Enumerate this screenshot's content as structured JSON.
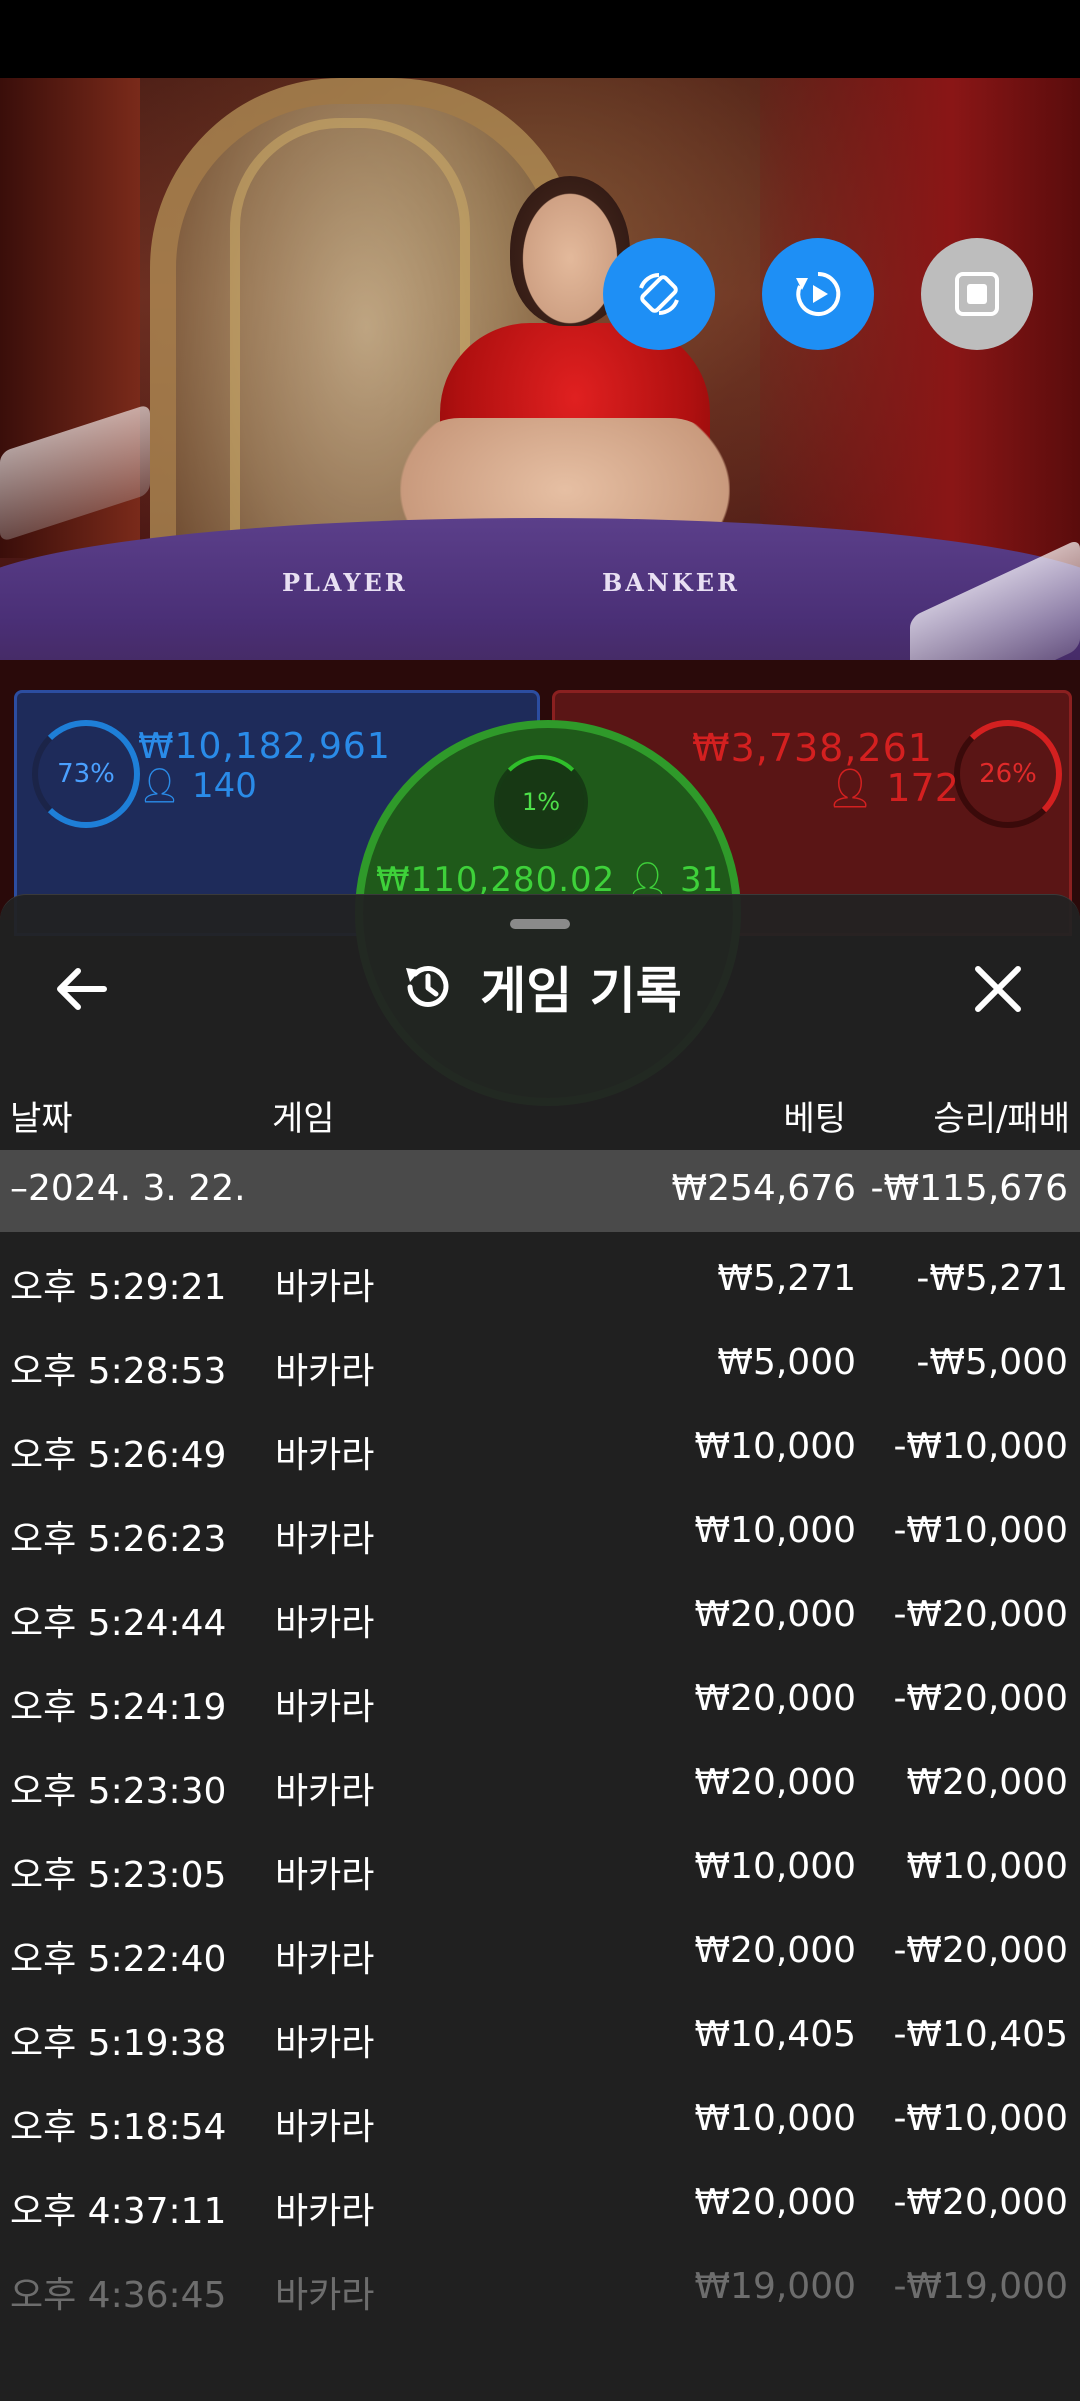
{
  "video": {
    "table_player_label": "PLAYER",
    "table_banker_label": "BANKER",
    "controls": [
      {
        "name": "rotate-icon"
      },
      {
        "name": "replay-icon"
      },
      {
        "name": "stop-icon"
      }
    ]
  },
  "bets": {
    "player": {
      "percent": "73%",
      "amount": "₩10,182,961",
      "people": "140",
      "color": "#1e7fd8"
    },
    "banker": {
      "percent": "26%",
      "amount": "₩3,738,261",
      "people": "172",
      "color": "#d42020"
    },
    "tie": {
      "percent": "1%",
      "amount": "₩110,280.02",
      "people": "31",
      "color": "#2fbf2a"
    }
  },
  "sheet": {
    "title": "게임 기록",
    "columns": {
      "date": "날짜",
      "game": "게임",
      "bet": "베팅",
      "result": "승리/패배"
    },
    "group": {
      "date": "–2024. 3. 22.",
      "bet": "₩254,676",
      "result": "-₩115,676"
    },
    "rows": [
      {
        "time": "오후 5:29:21",
        "game": "바카라",
        "bet": "₩5,271",
        "result": "-₩5,271"
      },
      {
        "time": "오후 5:28:53",
        "game": "바카라",
        "bet": "₩5,000",
        "result": "-₩5,000"
      },
      {
        "time": "오후 5:26:49",
        "game": "바카라",
        "bet": "₩10,000",
        "result": "-₩10,000"
      },
      {
        "time": "오후 5:26:23",
        "game": "바카라",
        "bet": "₩10,000",
        "result": "-₩10,000"
      },
      {
        "time": "오후 5:24:44",
        "game": "바카라",
        "bet": "₩20,000",
        "result": "-₩20,000"
      },
      {
        "time": "오후 5:24:19",
        "game": "바카라",
        "bet": "₩20,000",
        "result": "-₩20,000"
      },
      {
        "time": "오후 5:23:30",
        "game": "바카라",
        "bet": "₩20,000",
        "result": "₩20,000"
      },
      {
        "time": "오후 5:23:05",
        "game": "바카라",
        "bet": "₩10,000",
        "result": "₩10,000"
      },
      {
        "time": "오후 5:22:40",
        "game": "바카라",
        "bet": "₩20,000",
        "result": "-₩20,000"
      },
      {
        "time": "오후 5:19:38",
        "game": "바카라",
        "bet": "₩10,405",
        "result": "-₩10,405"
      },
      {
        "time": "오후 5:18:54",
        "game": "바카라",
        "bet": "₩10,000",
        "result": "-₩10,000"
      },
      {
        "time": "오후 4:37:11",
        "game": "바카라",
        "bet": "₩20,000",
        "result": "-₩20,000"
      },
      {
        "time": "오후 4:36:45",
        "game": "바카라",
        "bet": "₩19,000",
        "result": "-₩19,000"
      }
    ]
  }
}
